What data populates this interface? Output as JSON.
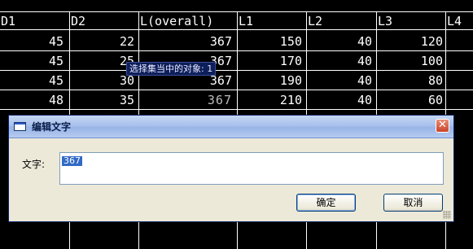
{
  "table": {
    "headers": [
      "D1",
      "D2",
      "L(overall)",
      "L1",
      "L2",
      "L3",
      "L4"
    ],
    "rows": [
      [
        "45",
        "22",
        "367",
        "150",
        "40",
        "120"
      ],
      [
        "45",
        "25",
        "367",
        "170",
        "40",
        "100"
      ],
      [
        "45",
        "30",
        "367",
        "190",
        "40",
        "80"
      ],
      [
        "48",
        "35",
        "367",
        "210",
        "40",
        "60"
      ]
    ]
  },
  "tooltip": "选择集当中的对象: 1",
  "dialog": {
    "title": "编辑文字",
    "label": "文字:",
    "value": "367",
    "ok": "确定",
    "cancel": "取消",
    "close_icon": "close-icon"
  }
}
